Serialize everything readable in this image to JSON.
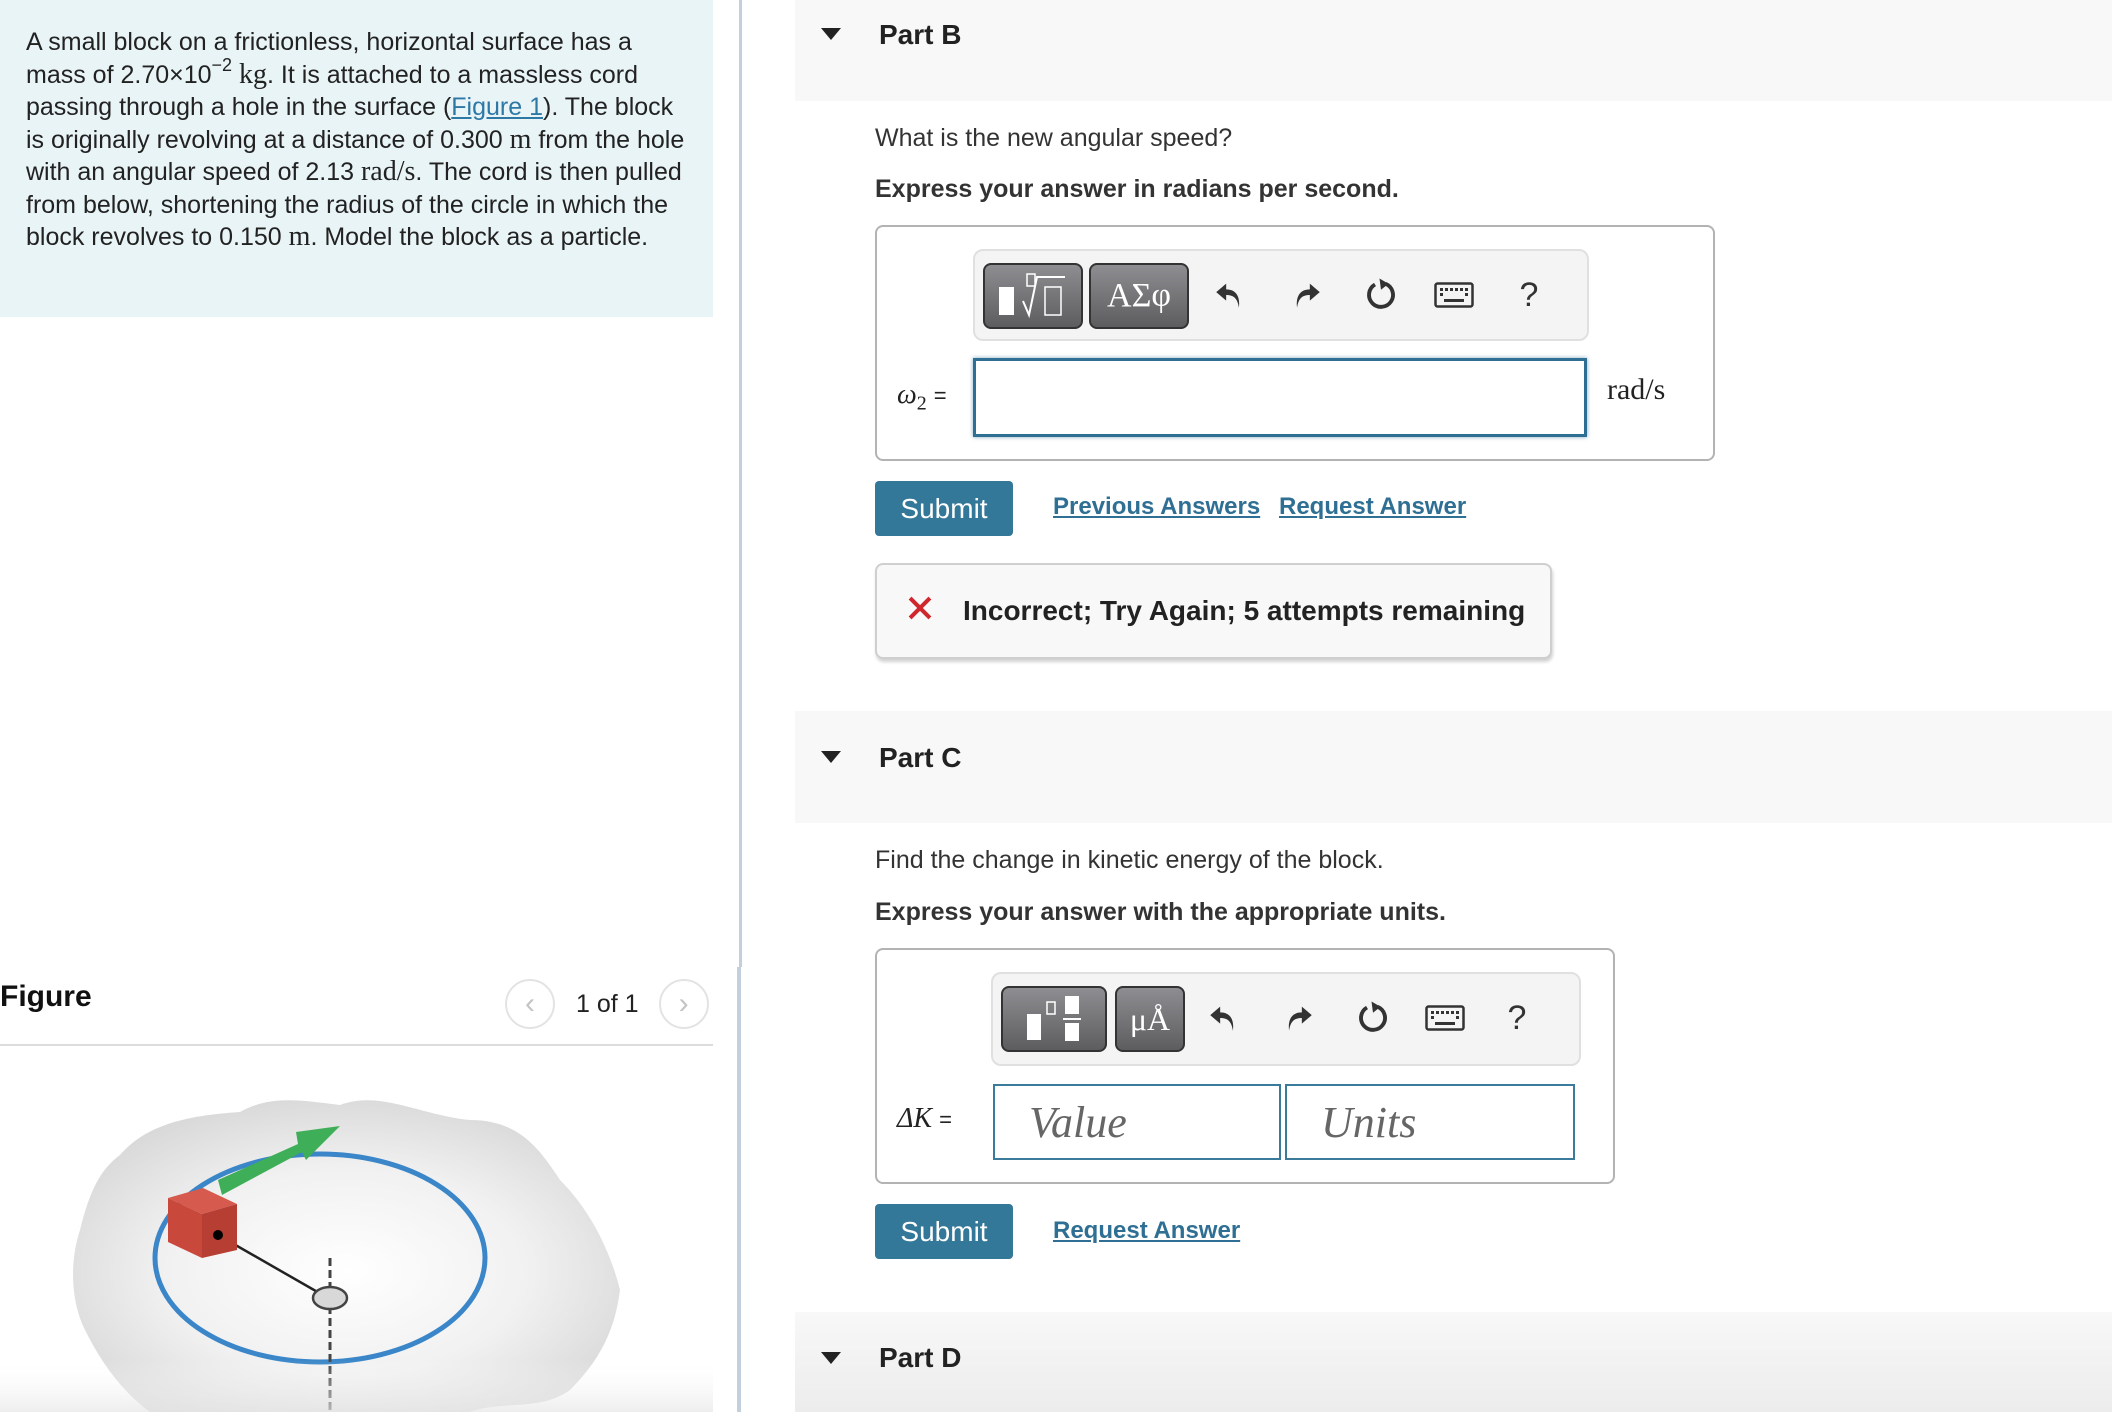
{
  "problem": {
    "text_1": "A small block on a frictionless, horizontal surface has a mass of 2.70×10",
    "mass_exponent": "−2",
    "mass_unit": "kg",
    "text_2": ". It is attached to a massless cord passing through a hole in the surface (",
    "figure_link": "Figure 1",
    "text_3": "). The block is originally revolving at a distance of 0.300 ",
    "unit_m": "m",
    "text_4": " from the hole with an angular speed of 2.13 ",
    "unit_rads": "rad/s",
    "text_5": ". The cord is then pulled from below, shortening the radius of the circle in which the block revolves to 0.150 ",
    "unit_m2": "m",
    "text_6": ". Model the block as a particle."
  },
  "figure": {
    "title": "Figure",
    "pager_text": "1 of 1",
    "prev_icon": "‹",
    "next_icon": "›",
    "colors": {
      "surface": "#e2e2e2",
      "path": "#3a86c8",
      "block": "#c9483c",
      "velocity_arrow": "#3fae58"
    }
  },
  "parts": {
    "b": {
      "title": "Part B",
      "question": "What is the new angular speed?",
      "instruction": "Express your answer in radians per second.",
      "toolbar": {
        "templates_icon": "templates-radical-icon",
        "greek": "ΑΣφ",
        "help": "?"
      },
      "variable_label": "ω",
      "variable_sub": "2",
      "equals": "=",
      "input_value": "",
      "unit": "rad/s",
      "submit_label": "Submit",
      "previous_answers_label": "Previous Answers",
      "request_answer_label": "Request Answer",
      "feedback": {
        "status": "incorrect",
        "message": "Incorrect; Try Again; 5 attempts remaining",
        "color": "#d0262d"
      }
    },
    "c": {
      "title": "Part C",
      "question": "Find the change in kinetic energy of the block.",
      "instruction": "Express your answer with the appropriate units.",
      "toolbar": {
        "templates_icon": "templates-fraction-icon",
        "units": "μÅ",
        "help": "?"
      },
      "variable_label": "ΔK",
      "equals": "=",
      "value_placeholder": "Value",
      "units_placeholder": "Units",
      "submit_label": "Submit",
      "request_answer_label": "Request Answer"
    },
    "d": {
      "title": "Part D"
    }
  },
  "colors": {
    "accent": "#347899",
    "link": "#2e6f93",
    "problem_bg": "#e9f4f7",
    "part_header_bg": "#f8f8f8"
  }
}
